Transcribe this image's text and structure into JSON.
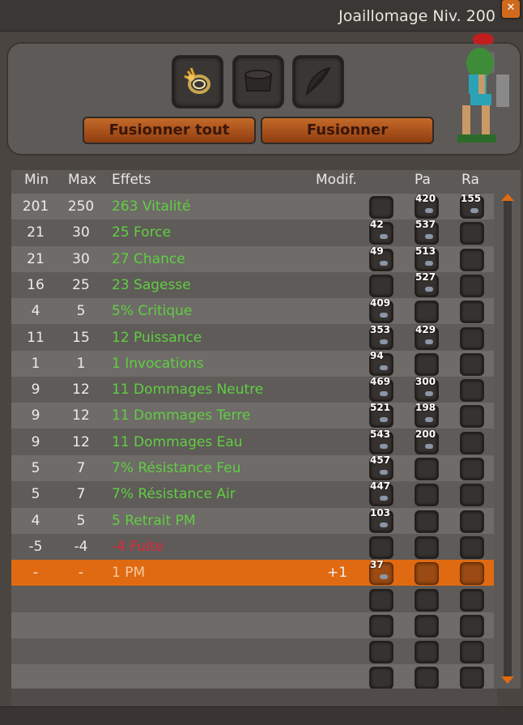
{
  "window": {
    "title": "Joaillomage Niv. 200",
    "close_icon": "close-icon",
    "colors": {
      "accent": "#e06a12",
      "positive": "#5fcf42",
      "negative": "#e0283a",
      "highlight": "#e06a12"
    }
  },
  "slots": [
    {
      "icon": "ring-icon"
    },
    {
      "icon": "pot-icon"
    },
    {
      "icon": "feather-icon"
    }
  ],
  "buttons": {
    "fuse_all": "Fusionner tout",
    "fuse": "Fusionner"
  },
  "table": {
    "headers": {
      "min": "Min",
      "max": "Max",
      "effects": "Effets",
      "modif": "Modif.",
      "pa": "Pa",
      "ra": "Ra"
    },
    "rows": [
      {
        "min": "201",
        "max": "250",
        "effect": "263 Vitalité",
        "tone": "positive",
        "modif": "",
        "c1": "",
        "c2": "420",
        "c3": "155",
        "highlight": false
      },
      {
        "min": "21",
        "max": "30",
        "effect": "25 Force",
        "tone": "positive",
        "modif": "",
        "c1": "42",
        "c2": "537",
        "c3": "",
        "highlight": false
      },
      {
        "min": "21",
        "max": "30",
        "effect": "27 Chance",
        "tone": "positive",
        "modif": "",
        "c1": "49",
        "c2": "513",
        "c3": "",
        "highlight": false
      },
      {
        "min": "16",
        "max": "25",
        "effect": "23 Sagesse",
        "tone": "positive",
        "modif": "",
        "c1": "",
        "c2": "527",
        "c3": "",
        "highlight": false
      },
      {
        "min": "4",
        "max": "5",
        "effect": "5% Critique",
        "tone": "positive",
        "modif": "",
        "c1": "409",
        "c2": "",
        "c3": "",
        "highlight": false
      },
      {
        "min": "11",
        "max": "15",
        "effect": "12 Puissance",
        "tone": "positive",
        "modif": "",
        "c1": "353",
        "c2": "429",
        "c3": "",
        "highlight": false
      },
      {
        "min": "1",
        "max": "1",
        "effect": "1 Invocations",
        "tone": "positive",
        "modif": "",
        "c1": "94",
        "c2": "",
        "c3": "",
        "highlight": false
      },
      {
        "min": "9",
        "max": "12",
        "effect": "11 Dommages Neutre",
        "tone": "positive",
        "modif": "",
        "c1": "469",
        "c2": "300",
        "c3": "",
        "highlight": false
      },
      {
        "min": "9",
        "max": "12",
        "effect": "11 Dommages Terre",
        "tone": "positive",
        "modif": "",
        "c1": "521",
        "c2": "198",
        "c3": "",
        "highlight": false
      },
      {
        "min": "9",
        "max": "12",
        "effect": "11 Dommages Eau",
        "tone": "positive",
        "modif": "",
        "c1": "543",
        "c2": "200",
        "c3": "",
        "highlight": false
      },
      {
        "min": "5",
        "max": "7",
        "effect": "7% Résistance Feu",
        "tone": "positive",
        "modif": "",
        "c1": "457",
        "c2": "",
        "c3": "",
        "highlight": false
      },
      {
        "min": "5",
        "max": "7",
        "effect": "7% Résistance Air",
        "tone": "positive",
        "modif": "",
        "c1": "447",
        "c2": "",
        "c3": "",
        "highlight": false
      },
      {
        "min": "4",
        "max": "5",
        "effect": "5 Retrait PM",
        "tone": "positive",
        "modif": "",
        "c1": "103",
        "c2": "",
        "c3": "",
        "highlight": false
      },
      {
        "min": "-5",
        "max": "-4",
        "effect": "-4 Fuite",
        "tone": "negative",
        "modif": "",
        "c1": "",
        "c2": "",
        "c3": "",
        "highlight": false
      },
      {
        "min": "-",
        "max": "-",
        "effect": "1 PM",
        "tone": "muted",
        "modif": "+1",
        "c1": "37",
        "c2": "",
        "c3": "",
        "highlight": true
      },
      {
        "min": "",
        "max": "",
        "effect": "",
        "tone": "positive",
        "modif": "",
        "c1": "",
        "c2": "",
        "c3": "",
        "highlight": false
      },
      {
        "min": "",
        "max": "",
        "effect": "",
        "tone": "positive",
        "modif": "",
        "c1": "",
        "c2": "",
        "c3": "",
        "highlight": false
      },
      {
        "min": "",
        "max": "",
        "effect": "",
        "tone": "positive",
        "modif": "",
        "c1": "",
        "c2": "",
        "c3": "",
        "highlight": false
      },
      {
        "min": "",
        "max": "",
        "effect": "",
        "tone": "positive",
        "modif": "",
        "c1": "",
        "c2": "",
        "c3": "",
        "highlight": false
      }
    ]
  }
}
